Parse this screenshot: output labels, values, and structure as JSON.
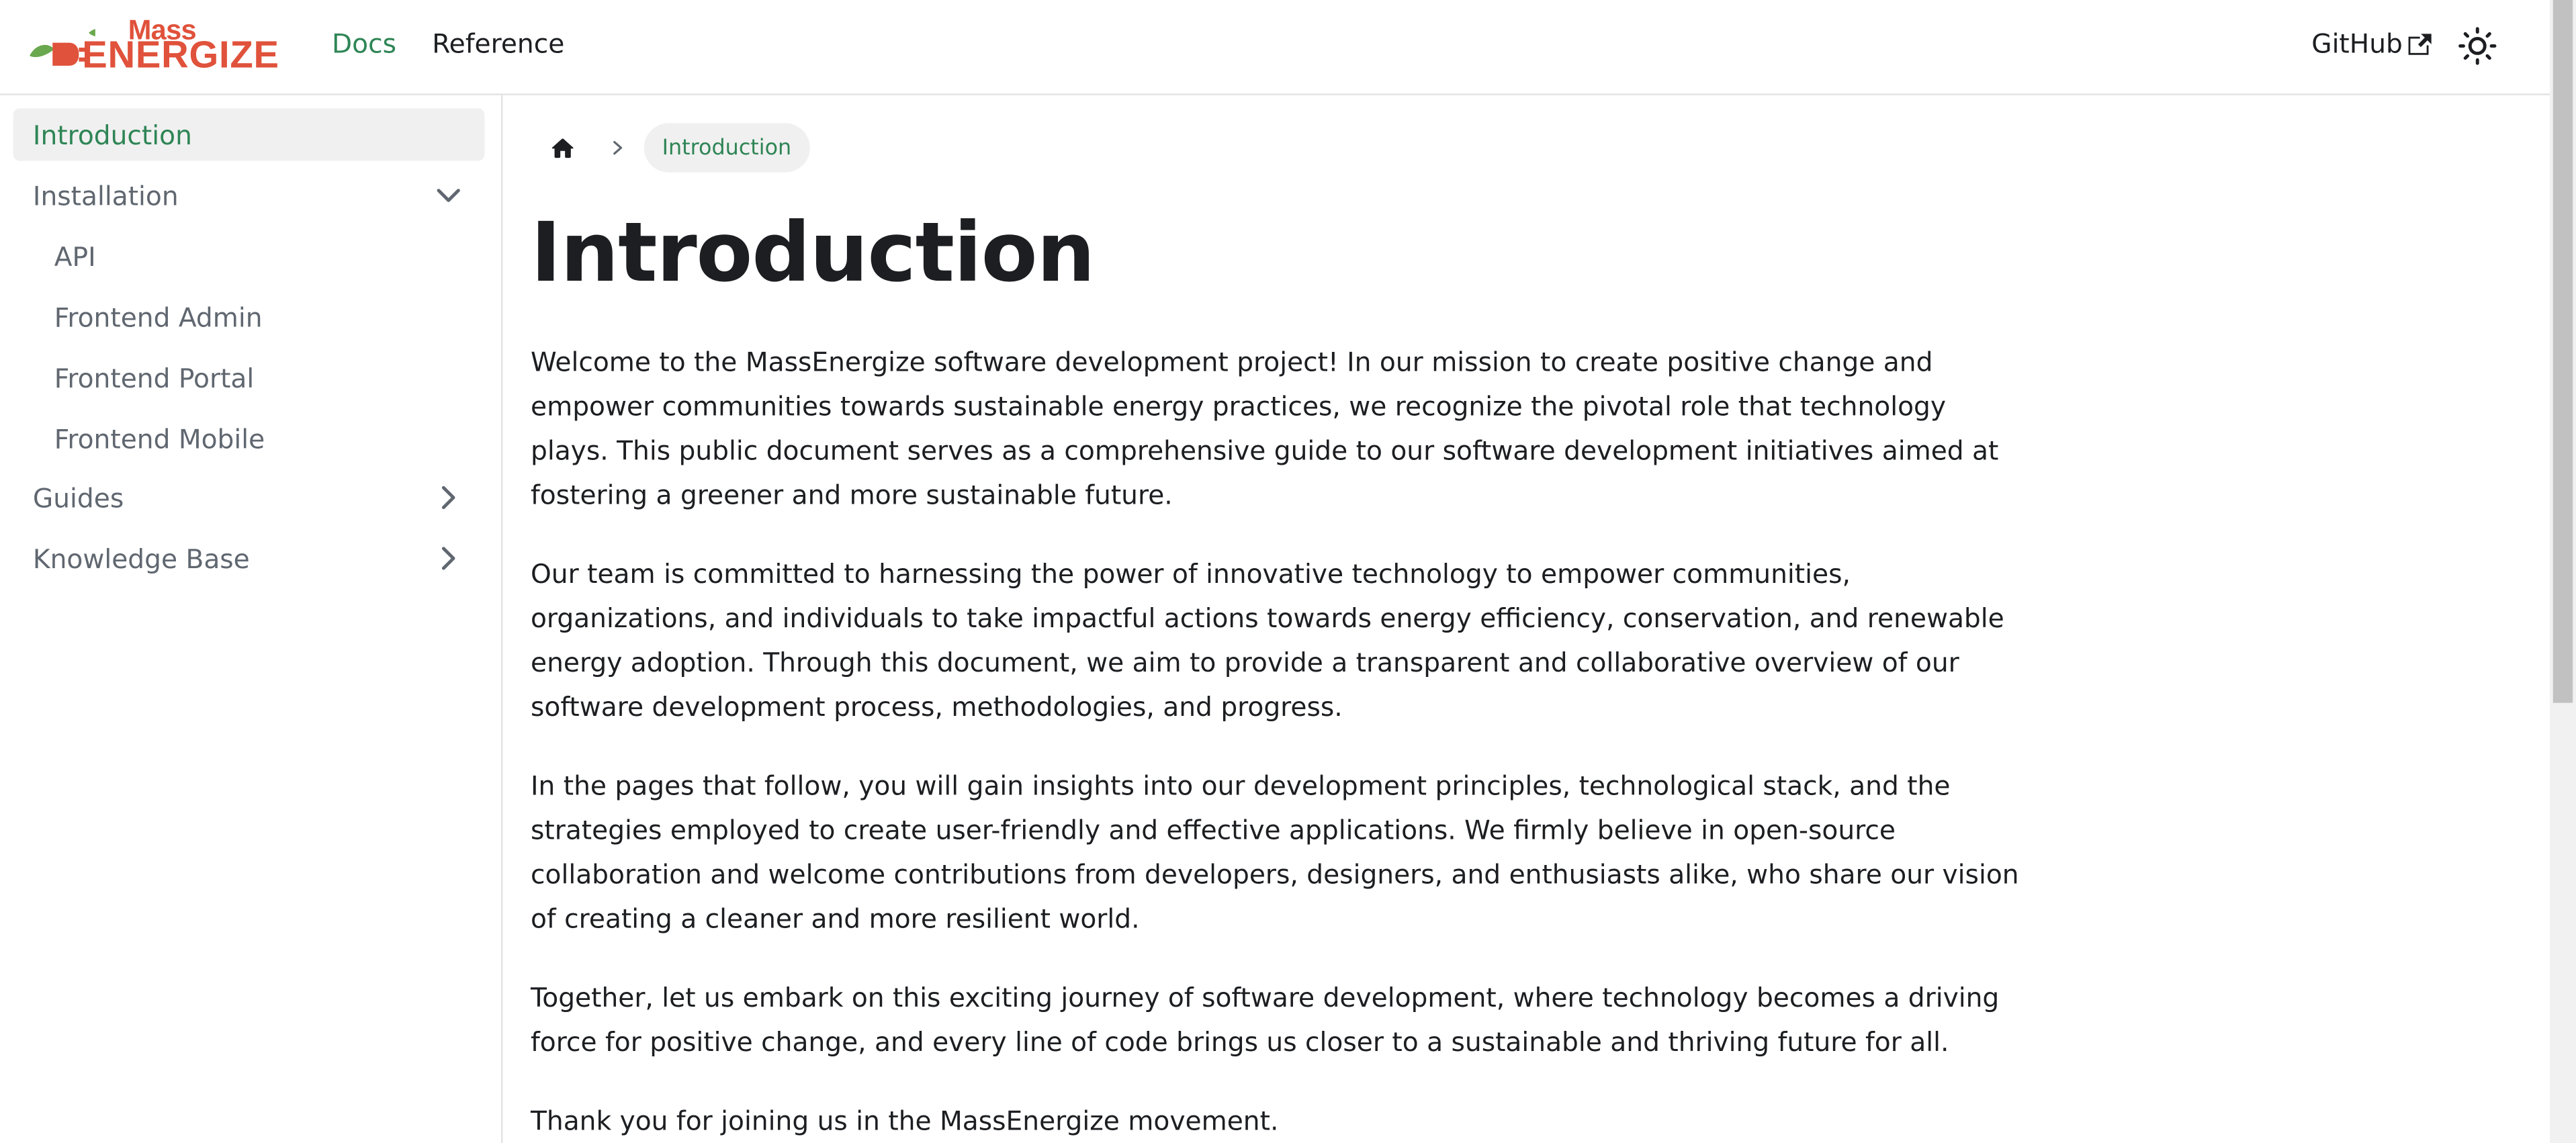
{
  "navbar": {
    "logo_top": "Mass",
    "logo_bottom": "ENERGIZE",
    "links": {
      "docs": "Docs",
      "reference": "Reference",
      "github": "GitHub"
    }
  },
  "sidebar": {
    "items": [
      {
        "label": "Introduction",
        "active": true
      },
      {
        "label": "Installation",
        "expanded": true
      },
      {
        "label": "API"
      },
      {
        "label": "Frontend Admin"
      },
      {
        "label": "Frontend Portal"
      },
      {
        "label": "Frontend Mobile"
      },
      {
        "label": "Guides",
        "expanded": false
      },
      {
        "label": "Knowledge Base",
        "expanded": false
      }
    ]
  },
  "breadcrumb": {
    "current": "Introduction"
  },
  "page": {
    "title": "Introduction",
    "paragraphs": [
      "Welcome to the MassEnergize software development project! In our mission to create positive change and empower communities towards sustainable energy practices, we recognize the pivotal role that technology plays. This public document serves as a comprehensive guide to our software development initiatives aimed at fostering a greener and more sustainable future.",
      "Our team is committed to harnessing the power of innovative technology to empower communities, organizations, and individuals to take impactful actions towards energy efficiency, conservation, and renewable energy adoption. Through this document, we aim to provide a transparent and collaborative overview of our software development process, methodologies, and progress.",
      "In the pages that follow, you will gain insights into our development principles, technological stack, and the strategies employed to create user-friendly and effective applications. We firmly believe in open-source collaboration and welcome contributions from developers, designers, and enthusiasts alike, who share our vision of creating a cleaner and more resilient world.",
      "Together, let us embark on this exciting journey of software development, where technology becomes a driving force for positive change, and every line of code brings us closer to a sustainable and thriving future for all.",
      "Thank you for joining us in the MassEnergize movement."
    ]
  },
  "colors": {
    "accent": "#2e8555",
    "brand": "#e0523b",
    "leaf": "#6aa84f"
  }
}
